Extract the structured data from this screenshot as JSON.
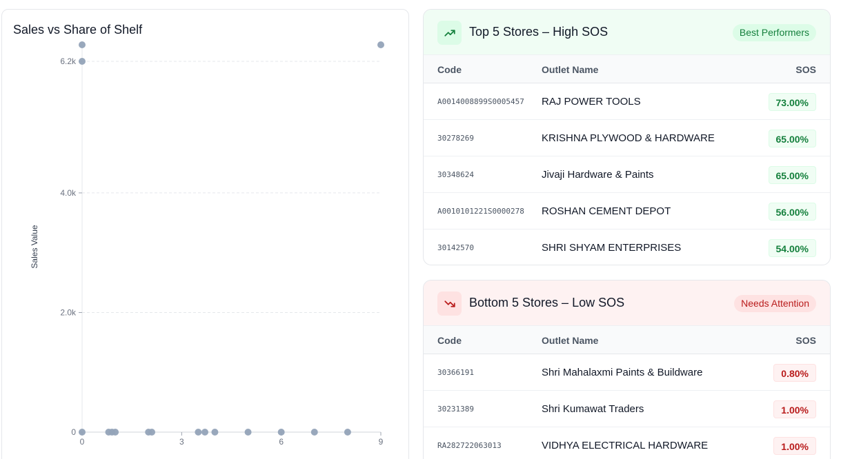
{
  "chart": {
    "title": "Sales vs Share of Shelf"
  },
  "chart_data": {
    "type": "scatter",
    "title": "Sales vs Share of Shelf",
    "xlabel": "",
    "ylabel": "Sales Value",
    "xlim": [
      0,
      9
    ],
    "ylim": [
      0,
      6200
    ],
    "x_ticks": [
      "0",
      "3",
      "6",
      "9"
    ],
    "y_ticks": [
      "0",
      "2.0k",
      "4.0k",
      "6.2k"
    ],
    "grid": true,
    "points": [
      {
        "x": 0,
        "y": 6200
      },
      {
        "x": 0,
        "y": 6500
      },
      {
        "x": 9,
        "y": 6500
      },
      {
        "x": 0,
        "y": 0
      },
      {
        "x": 0.8,
        "y": 0
      },
      {
        "x": 0.9,
        "y": 0
      },
      {
        "x": 1.0,
        "y": 0
      },
      {
        "x": 2.0,
        "y": 0
      },
      {
        "x": 2.1,
        "y": 0
      },
      {
        "x": 3.5,
        "y": 0
      },
      {
        "x": 3.7,
        "y": 0
      },
      {
        "x": 4.0,
        "y": 0
      },
      {
        "x": 5.0,
        "y": 0
      },
      {
        "x": 6.0,
        "y": 0
      },
      {
        "x": 7.0,
        "y": 0
      },
      {
        "x": 8.0,
        "y": 0
      }
    ],
    "color": "#94a3b8"
  },
  "top": {
    "title": "Top 5 Stores – High SOS",
    "badge": "Best Performers",
    "icon": "trending-up-icon",
    "headers": {
      "code": "Code",
      "name": "Outlet Name",
      "sos": "SOS"
    },
    "rows": [
      {
        "code": "A0014008899S0005457",
        "name": "RAJ POWER TOOLS",
        "sos": "73.00%"
      },
      {
        "code": "30278269",
        "name": "KRISHNA PLYWOOD & HARDWARE",
        "sos": "65.00%"
      },
      {
        "code": "30348624",
        "name": "Jivaji Hardware & Paints",
        "sos": "65.00%"
      },
      {
        "code": "A0010101221S0000278",
        "name": "ROSHAN CEMENT DEPOT",
        "sos": "56.00%"
      },
      {
        "code": "30142570",
        "name": "SHRI SHYAM ENTERPRISES",
        "sos": "54.00%"
      }
    ]
  },
  "bottom": {
    "title": "Bottom 5 Stores – Low SOS",
    "badge": "Needs Attention",
    "icon": "trending-down-icon",
    "headers": {
      "code": "Code",
      "name": "Outlet Name",
      "sos": "SOS"
    },
    "rows": [
      {
        "code": "30366191",
        "name": "Shri Mahalaxmi Paints & Buildware",
        "sos": "0.80%"
      },
      {
        "code": "30231389",
        "name": "Shri Kumawat Traders",
        "sos": "1.00%"
      },
      {
        "code": "RA282722063013",
        "name": "VIDHYA ELECTRICAL HARDWARE",
        "sos": "1.00%"
      }
    ]
  },
  "colors": {
    "green": "#15803d",
    "red": "#b91c1c",
    "point": "#94a3b8"
  }
}
